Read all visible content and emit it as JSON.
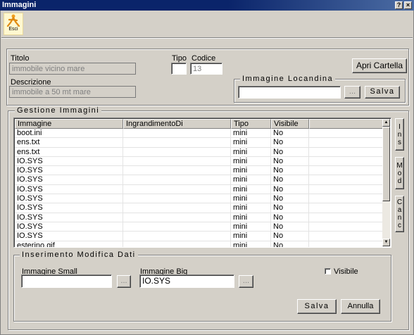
{
  "window": {
    "title": "Immagini",
    "help_label": "?",
    "close_label": "×"
  },
  "toolbar": {
    "esci_label": "Esci"
  },
  "form": {
    "titolo_label": "Titolo",
    "titolo_value": "immobile vicino mare",
    "tipo_label": "Tipo",
    "tipo_value": "",
    "codice_label": "Codice",
    "codice_value": "13",
    "descrizione_label": "Descrizione",
    "descrizione_value": "immobile a 50 mt mare",
    "apri_cartella_label": "Apri Cartella"
  },
  "locandina": {
    "legend": "Immagine Locandina",
    "value": "",
    "browse_label": "...",
    "salva_label": "Salva"
  },
  "gestione": {
    "legend": "Gestione Immagini",
    "columns": [
      "Immagine",
      "IngrandimentoDi",
      "Tipo",
      "Visibile"
    ],
    "rows": [
      [
        "boot.ini",
        "",
        "mini",
        "No"
      ],
      [
        "ens.txt",
        "",
        "mini",
        "No"
      ],
      [
        "ens.txt",
        "",
        "mini",
        "No"
      ],
      [
        "IO.SYS",
        "",
        "mini",
        "No"
      ],
      [
        "IO.SYS",
        "",
        "mini",
        "No"
      ],
      [
        "IO.SYS",
        "",
        "mini",
        "No"
      ],
      [
        "IO.SYS",
        "",
        "mini",
        "No"
      ],
      [
        "IO.SYS",
        "",
        "mini",
        "No"
      ],
      [
        "IO.SYS",
        "",
        "mini",
        "No"
      ],
      [
        "IO.SYS",
        "",
        "mini",
        "No"
      ],
      [
        "IO.SYS",
        "",
        "mini",
        "No"
      ],
      [
        "IO.SYS",
        "",
        "mini",
        "No"
      ],
      [
        "esterino.gif",
        "",
        "mini",
        "No"
      ]
    ],
    "side_buttons": {
      "ins": [
        "I",
        "n",
        "s"
      ],
      "mod": [
        "M",
        "o",
        "d"
      ],
      "canc": [
        "C",
        "a",
        "n",
        "c"
      ]
    },
    "scroll_up": "▲",
    "scroll_down": "▼"
  },
  "inserimento": {
    "legend": "Inserimento Modifica Dati",
    "small_label": "Immagine Small",
    "small_value": "",
    "small_browse": "...",
    "big_label": "Immagine Big",
    "big_value": "IO.SYS",
    "big_browse": "...",
    "visibile_label": "Visibile",
    "visibile_checked": false,
    "salva_label": "Salva",
    "annulla_label": "Annulla"
  },
  "colors": {
    "titlebar": "#0a246a",
    "face": "#d4d0c8",
    "disabled_text": "#808080"
  }
}
